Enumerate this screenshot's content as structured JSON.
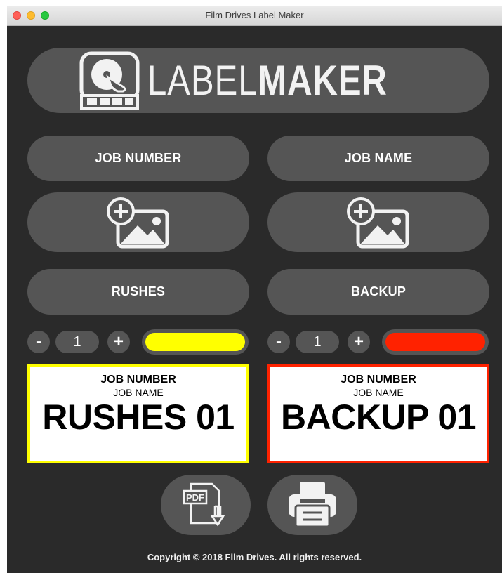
{
  "window": {
    "title": "Film Drives Label Maker"
  },
  "logo": {
    "part1": "LABEL",
    "part2": "MAKER"
  },
  "fields": {
    "job_number_label": "JOB NUMBER",
    "job_name_label": "JOB NAME"
  },
  "types": {
    "left": "RUSHES",
    "right": "BACKUP"
  },
  "controls": {
    "left": {
      "minus": "-",
      "count": "1",
      "plus": "+",
      "color": "#ffff00"
    },
    "right": {
      "minus": "-",
      "count": "1",
      "plus": "+",
      "color": "#ff2200"
    }
  },
  "labels": {
    "left": {
      "job_number": "JOB NUMBER",
      "job_name": "JOB NAME",
      "main": "RUSHES 01",
      "border_color": "#ffff00"
    },
    "right": {
      "job_number": "JOB NUMBER",
      "job_name": "JOB NAME",
      "main": "BACKUP 01",
      "border_color": "#ff2200"
    }
  },
  "actions": {
    "pdf_icon_text": "PDF",
    "pdf_icon": "pdf-download-icon",
    "print_icon": "printer-icon"
  },
  "footer": {
    "copyright": "Copyright © 2018 Film Drives. All rights reserved."
  },
  "colors": {
    "background": "#2a2a2a",
    "button": "#555555",
    "text": "#ffffff"
  }
}
